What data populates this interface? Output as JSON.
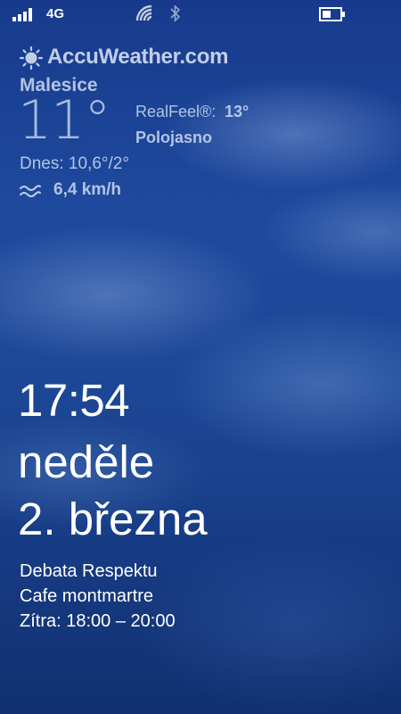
{
  "status_bar": {
    "network_type": "4G",
    "icons": [
      "signal-strength-icon",
      "wifi-icon",
      "bluetooth-icon",
      "battery-icon"
    ],
    "signal_bars": 4,
    "battery_level": 0.5
  },
  "weather": {
    "brand": "AccuWeather.com",
    "location": "Malesice",
    "temperature": "11°",
    "realfeel_label": "RealFeel®:",
    "realfeel_value": "13°",
    "condition": "Polojasno",
    "today": "Dnes: 10,6°/2°",
    "wind": "6,4 km/h",
    "icons": [
      "sun-icon",
      "wind-icon"
    ]
  },
  "lock_screen": {
    "time": "17:54",
    "weekday": "neděle",
    "date": "2. března"
  },
  "event": {
    "title": "Debata Respektu",
    "location": "Cafe montmartre",
    "time": "Zítra: 18:00 – 20:00"
  },
  "colors": {
    "sky_dark": "#10306f",
    "sky_mid": "#1e4a9e",
    "text": "#ffffff",
    "widget_text": "#cedaf0"
  }
}
